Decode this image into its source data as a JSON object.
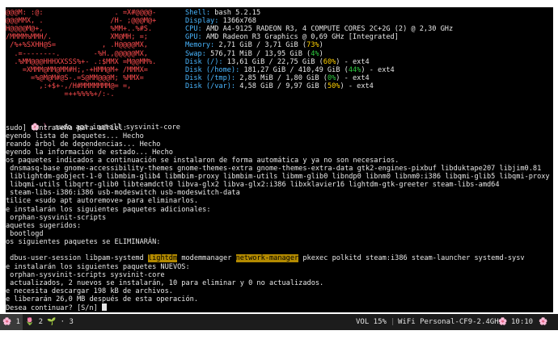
{
  "logo": [
    "@@@M: :@:                 . =X#@@@@-",
    "@@@MMX, .                /H- ;@@@M@+",
    "H@@@@M@+,                %MM+..%#S.",
    "/MMMM%MMH/.              XM@MH; =;",
    " /%+%SXHH@S=           , .H@@@@MX,",
    "  .=--------.        -%H.,@@@@@MX,",
    "  .%MM@@@HHHXXSSS%+- .:$MMX =M@@MM%.",
    "    =XMMM@MM@MM#H;,-+HMM@M+ /MMMX=",
    "      =%@M@M#@S-.=S@MM@@@M; %MMX=",
    "        ,:+$+-,/H#MMMMMMM@= =,",
    "              =++%%%%+/:-."
  ],
  "sysinfo": [
    {
      "key": "Shell:",
      "value": "bash 5.2.15"
    },
    {
      "key": "Display:",
      "value": "1366x768"
    },
    {
      "key": "CPU:",
      "value": "AMD A4-9125 RADEON R3, 4 COMPUTE CORES 2C+2G (2) @ 2,30 GHz"
    },
    {
      "key": "GPU:",
      "value": "AMD Radeon R3 Graphics @ 0,69 GHz [Integrated]"
    },
    {
      "key": "Memory:",
      "value": "2,71 GiB / 3,71 GiB (",
      "pct": "73%",
      "tail": ")",
      "pct_color": "y"
    },
    {
      "key": "Swap:",
      "value": "576,71 MiB / 13,95 GiB (",
      "pct": "4%",
      "tail": ")",
      "pct_color": "g"
    },
    {
      "key": "Disk (/):",
      "value": "13,61 GiB / 22,75 GiB (",
      "pct": "60%",
      "tail": ") - ext4",
      "pct_color": "y"
    },
    {
      "key": "Disk (/home):",
      "value": "181,27 GiB / 410,49 GiB (",
      "pct": "44%",
      "tail": ") - ext4",
      "pct_color": "g"
    },
    {
      "key": "Disk (/tmp):",
      "value": "2,85 MiB / 1,80 GiB (",
      "pct": "0%",
      "tail": ") - ext4",
      "pct_color": "g"
    },
    {
      "key": "Disk (/var):",
      "value": "4,58 GiB / 9,97 GiB (",
      "pct": "50%",
      "tail": ") - ext4",
      "pct_color": "y"
    }
  ],
  "command": {
    "prompt_icon": "🌸 〉",
    "text": "sudo apt install sysvinit-core"
  },
  "output": [
    "sudo] contraseña para adriel:",
    "eyendo lista de paquetes... Hecho",
    "reando árbol de dependencias... Hecho",
    "eyendo la información de estado... Hecho",
    "os paquetes indicados a continuación se instalaron de forma automática y ya no son necesarios.",
    " dnsmasq-base gnome-accessibility-themes gnome-themes-extra gnome-themes-extra-data gtk2-engines-pixbuf libduktape207 libjim0.81",
    " liblightdm-gobject-1-0 libmbim-glib4 libmbim-proxy libmbim-utils libmm-glib0 libndp0 libnm0 libnm0:i386 libqmi-glib5 libqmi-proxy",
    " libqmi-utils libqrtr-glib0 libteamdctl0 libva-glx2 libva-glx2:i386 libxklavier16 lightdm-gtk-greeter steam-libs-amd64",
    " steam-libs-i386:i386 usb-modeswitch usb-modeswitch-data",
    "tilice «sudo apt autoremove» para eliminarlos.",
    "e instalarán los siguientes paquetes adicionales:",
    " orphan-sysvinit-scripts",
    "aquetes sugeridos:",
    " bootlogd",
    "os siguientes paquetes se ELIMINARÁN:"
  ],
  "removed_line": {
    "a": " dbus-user-session libpam-systemd ",
    "h1": "lightdm",
    "b": " modemmanager ",
    "h2": "network-manager",
    "c": " pkexec polkitd steam:i386 steam-launcher systemd-sysv"
  },
  "output2": [
    "e instalarán los siguientes paquetes NUEVOS:",
    " orphan-sysvinit-scripts sysvinit-core",
    " actualizados, 2 nuevos se instalarán, 10 para eliminar y 0 no actualizados.",
    "e necesita descargar 198 kB de archivos.",
    "e liberarán 26,0 MB después de esta operación.",
    "Desea continuar? [S/n] "
  ],
  "taskbar": {
    "workspaces": [
      {
        "icon": "🌸",
        "num": "1"
      },
      {
        "icon": "🌷",
        "num": "2"
      },
      {
        "icon": "🌱",
        "num": "·"
      },
      {
        "num": "3"
      }
    ],
    "volume": "VOL 15%",
    "wifi": "WiFi Personal-CF9-2.4GHz",
    "cpu_icon": "🌸",
    "clock": "10:10",
    "end_icon": "🌸"
  }
}
